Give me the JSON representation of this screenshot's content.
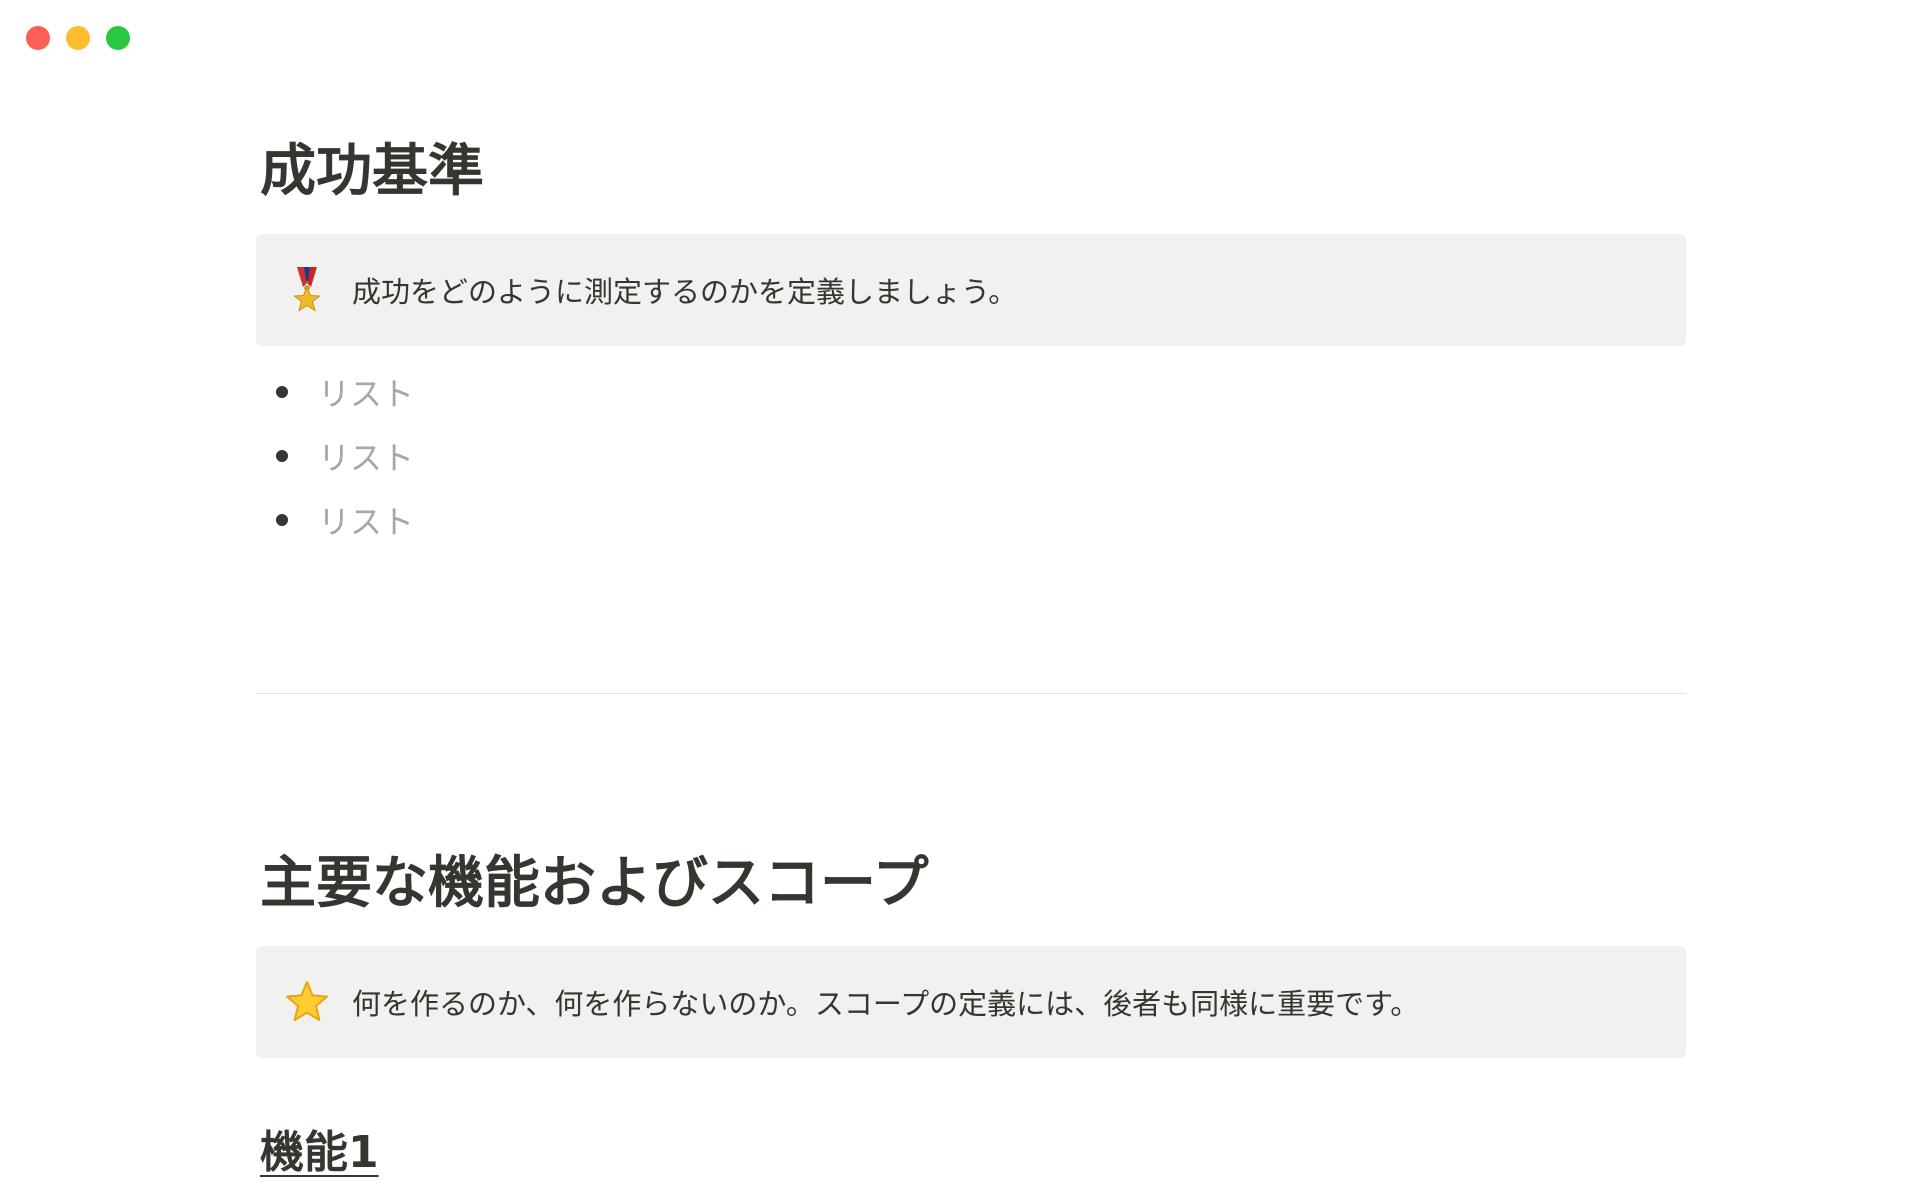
{
  "window_controls": {
    "close_color": "#fe5f57",
    "minimize_color": "#febc2e",
    "zoom_color": "#28c840"
  },
  "sections": [
    {
      "title": "成功基準",
      "callout": {
        "icon": "medal-icon",
        "text": "成功をどのように測定するのかを定義しましょう。"
      },
      "bullets": [
        "リスト",
        "リスト",
        "リスト"
      ]
    },
    {
      "title": "主要な機能およびスコープ",
      "callout": {
        "icon": "star-icon",
        "text": "何を作るのか、何を作らないのか。スコープの定義には、後者も同様に重要です。"
      },
      "subheading": "機能1"
    }
  ]
}
